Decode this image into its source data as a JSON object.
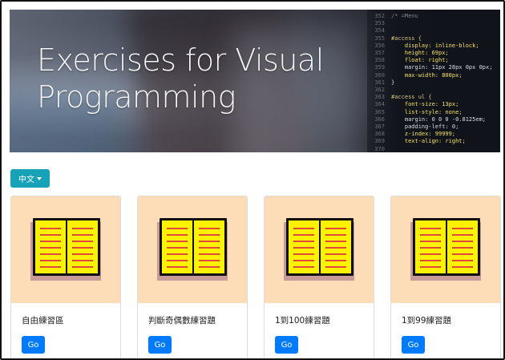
{
  "hero": {
    "title_line1": "Exercises for Visual",
    "title_line2": "Programming",
    "code_gutter": [
      "352",
      "353",
      "354",
      "355",
      "356",
      "357",
      "358",
      "359",
      "360",
      "361",
      "362",
      "363",
      "364",
      "365",
      "366",
      "367",
      "368",
      "369",
      "370"
    ],
    "code_lines": [
      "/* =Menu",
      "",
      "",
      "#access {",
      "    display: inline-block;",
      "    height: 69px;",
      "    float: right;",
      "    margin: 11px 28px 0px 0px;",
      "    max-width: 800px;",
      "}",
      "",
      "#access ul {",
      "    font-size: 13px;",
      "    list-style: none;",
      "    margin: 0 0 0 -0.8125em;",
      "    padding-left: 0;",
      "    z-index: 99999;",
      "    text-align: right;",
      ""
    ]
  },
  "language": {
    "label": "中文"
  },
  "cards": [
    {
      "title": "自由練習區",
      "button": "Go"
    },
    {
      "title": "判斷奇偶數練習題",
      "button": "Go"
    },
    {
      "title": "1到100練習題",
      "button": "Go"
    },
    {
      "title": "1到99練習題",
      "button": "Go"
    }
  ],
  "colors": {
    "language_button": "#17a2b8",
    "go_button": "#007bff",
    "card_image_bg": "#fddcb8",
    "book_page": "#fff200",
    "book_lines": "#e04a3a"
  }
}
